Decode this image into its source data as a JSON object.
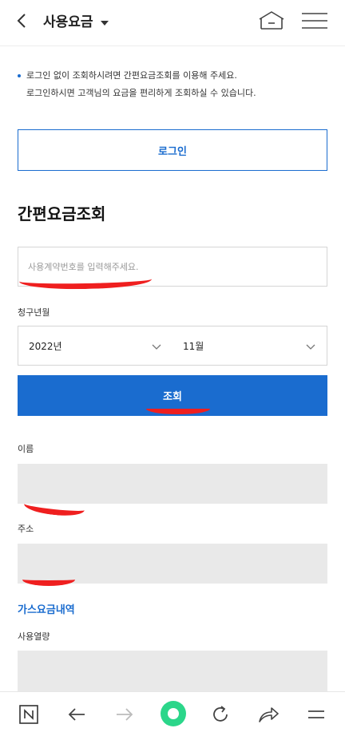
{
  "header": {
    "title": "사용요금",
    "back_icon": "chevron-left-icon",
    "home_icon": "home-icon",
    "menu_icon": "hamburger-menu-icon"
  },
  "notice": {
    "line1": "로그인 없이 조회하시려면 간편요금조회를 이용해 주세요.",
    "line2": "로그인하시면 고객님의 요금을 편리하게 조회하실 수 있습니다."
  },
  "login_button": "로그인",
  "section_title": "간편요금조회",
  "contract_input": {
    "placeholder": "사용계약번호를 입력해주세요.",
    "value": ""
  },
  "billing_month": {
    "label": "청구년월",
    "year": "2022년",
    "month": "11월"
  },
  "search_button": "조회",
  "fields": {
    "name_label": "이름",
    "address_label": "주소"
  },
  "gas_section": {
    "title": "가스요금내역",
    "usage_label": "사용열량"
  },
  "bottom_bar": {
    "icons": [
      "naver-n-icon",
      "back-arrow-icon",
      "forward-arrow-icon",
      "green-circle-icon",
      "refresh-icon",
      "share-icon",
      "menu-icon"
    ]
  },
  "colors": {
    "accent": "#1a6ccf",
    "field_bg": "#e9e9e9",
    "redaction": "#ef1f1f",
    "green_button": "#2bd68a"
  }
}
